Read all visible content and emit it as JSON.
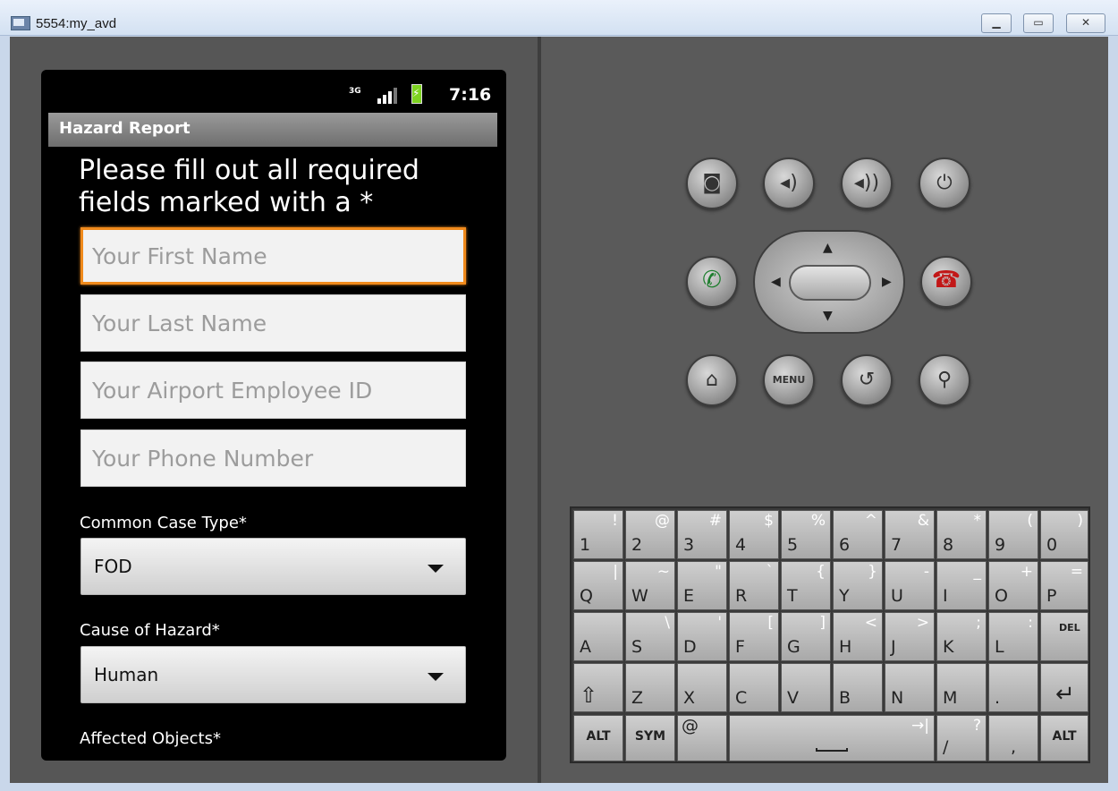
{
  "window": {
    "title": "5554:my_avd"
  },
  "status_bar": {
    "network": "3G",
    "time": "7:16"
  },
  "app": {
    "title": "Hazard Report",
    "instructions": "Please fill out all required fields marked with a *",
    "fields": {
      "first_name": "Your First Name",
      "last_name": "Your Last Name",
      "employee_id": "Your Airport Employee ID",
      "phone": "Your Phone Number"
    },
    "case_type": {
      "label": "Common Case Type*",
      "value": "FOD"
    },
    "cause": {
      "label": "Cause of Hazard*",
      "value": "Human"
    },
    "affected": {
      "label": "Affected Objects*"
    }
  },
  "controls": {
    "menu_label": "MENU"
  },
  "keyboard": {
    "rows": [
      [
        [
          "1",
          "!"
        ],
        [
          "2",
          "@"
        ],
        [
          "3",
          "#"
        ],
        [
          "4",
          "$"
        ],
        [
          "5",
          "%"
        ],
        [
          "6",
          "^"
        ],
        [
          "7",
          "&"
        ],
        [
          "8",
          "*"
        ],
        [
          "9",
          "("
        ],
        [
          "0",
          ")"
        ]
      ],
      [
        [
          "Q",
          "|"
        ],
        [
          "W",
          "~"
        ],
        [
          "E",
          "\""
        ],
        [
          "R",
          "`"
        ],
        [
          "T",
          "{"
        ],
        [
          "Y",
          "}"
        ],
        [
          "U",
          "-"
        ],
        [
          "I",
          "_"
        ],
        [
          "O",
          "+"
        ],
        [
          "P",
          "="
        ]
      ],
      [
        [
          "A",
          ""
        ],
        [
          "S",
          "\\"
        ],
        [
          "D",
          "'"
        ],
        [
          "F",
          "["
        ],
        [
          "G",
          "]"
        ],
        [
          "H",
          "<"
        ],
        [
          "J",
          ">"
        ],
        [
          "K",
          ";"
        ],
        [
          "L",
          ":"
        ],
        [
          "DEL",
          ""
        ]
      ],
      [
        [
          "⇧",
          ""
        ],
        [
          "Z",
          ""
        ],
        [
          "X",
          ""
        ],
        [
          "C",
          ""
        ],
        [
          "V",
          ""
        ],
        [
          "B",
          ""
        ],
        [
          "N",
          ""
        ],
        [
          "M",
          ""
        ],
        [
          ".",
          ""
        ],
        [
          "↵",
          ""
        ]
      ]
    ],
    "bottom": {
      "alt": "ALT",
      "sym": "SYM",
      "at": "@",
      "tab": "→|",
      "slash": "/",
      "question": "?",
      "comma": ","
    }
  }
}
